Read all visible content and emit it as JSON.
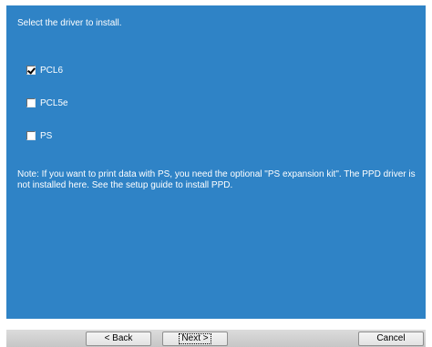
{
  "instruction": "Select the driver to install.",
  "options": [
    {
      "label": "PCL6",
      "checked": true
    },
    {
      "label": "PCL5e",
      "checked": false
    },
    {
      "label": "PS",
      "checked": false
    }
  ],
  "note": "Note: If you want to print data with PS, you need the optional \"PS expansion kit\". The PPD driver is not installed here. See the setup guide to install PPD.",
  "buttons": {
    "back": "< Back",
    "next": "Next >",
    "cancel": "Cancel"
  },
  "colors": {
    "panel_background": "#2f83c6",
    "text": "#ffffff"
  }
}
